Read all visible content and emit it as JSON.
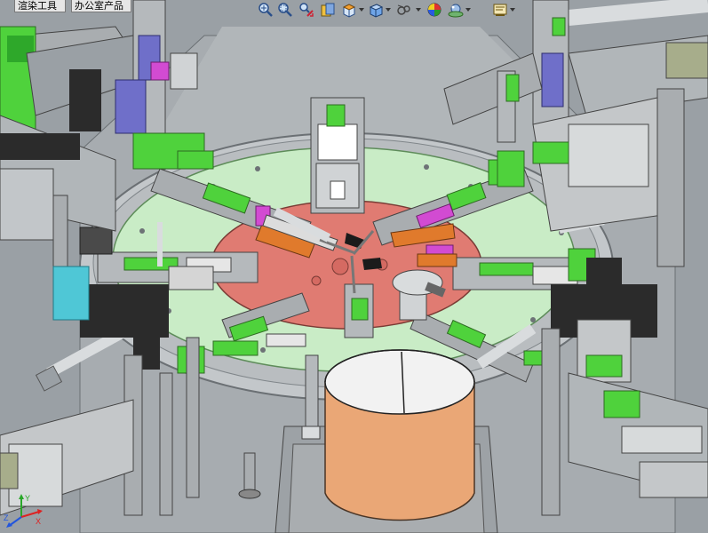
{
  "tabs": [
    {
      "label": "渲染工具"
    },
    {
      "label": "办公室产品"
    }
  ],
  "toolbar": {
    "items": [
      {
        "icon": "zoom-to-fit-icon"
      },
      {
        "icon": "zoom-to-area-icon"
      },
      {
        "icon": "previous-view-icon"
      },
      {
        "icon": "section-view-icon"
      },
      {
        "icon": "view-orientation-icon",
        "dropdown": true
      },
      {
        "icon": "display-style-icon",
        "dropdown": true
      },
      {
        "icon": "hide-show-items-icon",
        "dropdown": true
      },
      {
        "icon": "edit-appearance-icon"
      },
      {
        "icon": "apply-scene-icon",
        "dropdown": true
      },
      {
        "icon": "view-settings-icon",
        "dropdown": true
      }
    ]
  },
  "triad": {
    "axes": [
      "X",
      "Y",
      "Z"
    ]
  },
  "colors": {
    "table_top": "#9aa0a5",
    "outer_ring": "#c3c7ca",
    "dial_plate": "#c9ecc6",
    "rotary_center": "#e07b72",
    "cylinder_body": "#eaa776",
    "cylinder_top": "#f2f2f2",
    "accent_green": "#4fd23c",
    "accent_blue": "#6f6fc9",
    "accent_magenta": "#d24bd2",
    "accent_orange": "#e07a2c",
    "frame_gray": "#a9adb0",
    "dark": "#2b2b2b"
  }
}
